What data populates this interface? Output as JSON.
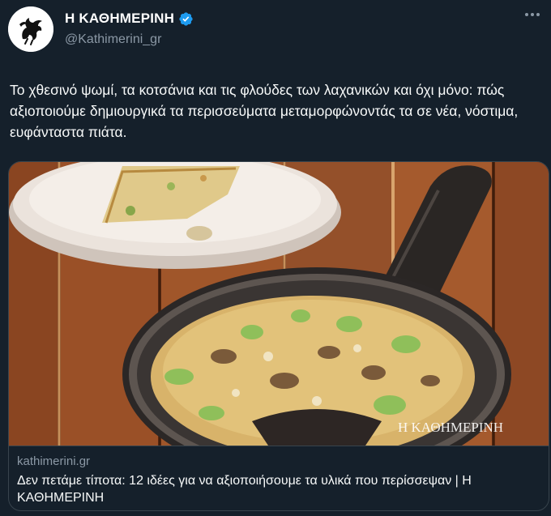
{
  "author": {
    "display_name": "Η ΚΑΘΗΜΕΡΙΝΗ",
    "handle": "@Kathimerini_gr",
    "verified": true,
    "avatar_icon": "griffin-logo-icon"
  },
  "tweet": {
    "text": "Το χθεσινό ψωμί, τα κοτσάνια και τις φλούδες των λαχανικών και όχι μόνο: πώς αξιοποιούμε δημιουργικά τα περισσεύματα μεταμορφώνοντάς τα σε νέα, νόστιμα, ευφάνταστα πιάτα."
  },
  "link_card": {
    "image_watermark": "Η ΚΑΘΗΜΕΡΙΝΗ",
    "domain": "kathimerini.gr",
    "title": "Δεν πετάμε τίποτα: 12 ιδέες για να αξιοποιήσουμε τα υλικά που περίσσεψαν | Η ΚΑΘΗΜΕΡΙΝΗ"
  },
  "colors": {
    "background": "#15202b",
    "verified_badge": "#1d9bf0",
    "secondary_text": "#8b98a5",
    "border": "#38444d"
  }
}
